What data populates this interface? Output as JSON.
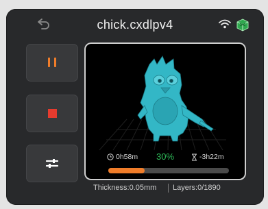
{
  "header": {
    "title": "chick.cxdlpv4",
    "back_icon": "back-arrow-icon",
    "wifi_icon": "wifi-icon",
    "model_icon": "cube-icon"
  },
  "controls": {
    "pause_icon": "pause-icon",
    "stop_icon": "stop-icon",
    "settings_icon": "sliders-icon"
  },
  "print": {
    "elapsed": "0h58m",
    "percent": "30%",
    "progress": 0.3,
    "remaining": "-3h22m"
  },
  "footer": {
    "thickness": "Thickness:0.05mm",
    "layers": "Layers:0/1890"
  },
  "colors": {
    "accent": "#f07d2a",
    "stop": "#e63b2e",
    "percent": "#2fbf5b",
    "model": "#33b7c6"
  }
}
